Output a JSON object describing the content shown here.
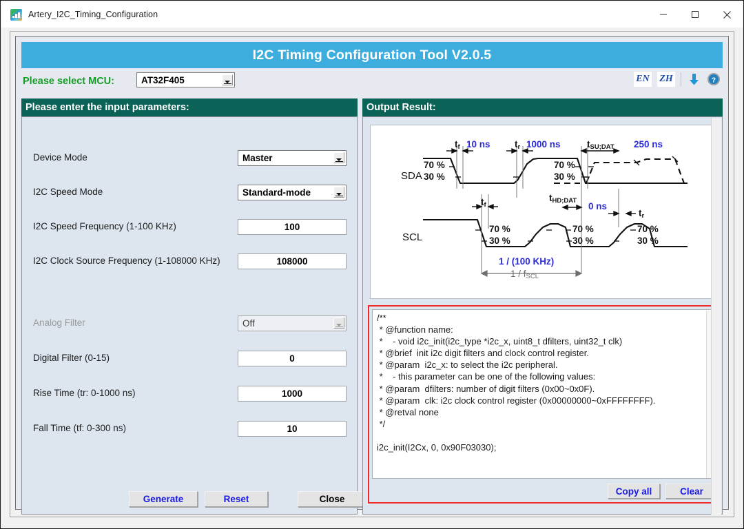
{
  "window": {
    "title": "Artery_I2C_Timing_Configuration",
    "app_icon": "artery-logo-icon",
    "controls": {
      "minimize": "minimize-icon",
      "maximize": "maximize-icon",
      "close": "close-icon"
    }
  },
  "banner": {
    "title": "I2C Timing Configuration Tool V2.0.5",
    "bg_color": "#3daddd",
    "text_color": "#ffffff"
  },
  "mcu": {
    "label": "Please select MCU:",
    "label_color": "#149d26",
    "selected": "AT32F405"
  },
  "toolbar": {
    "lang_en": "EN",
    "lang_zh": "ZH",
    "download_icon": "download-arrow-icon",
    "help_icon": "help-question-icon",
    "accent_color": "#1e49a8"
  },
  "left_panel": {
    "header": "Please enter the input parameters:",
    "header_bg": "#0b6358",
    "fields": [
      {
        "label": "Device Mode",
        "type": "combo",
        "value": "Master",
        "disabled": false
      },
      {
        "label": "I2C Speed Mode",
        "type": "combo",
        "value": "Standard-mode",
        "disabled": false
      },
      {
        "label": "I2C Speed Frequency (1-100 KHz)",
        "type": "text",
        "value": "100",
        "disabled": false
      },
      {
        "label": "I2C Clock Source Frequency (1-108000 KHz)",
        "type": "text",
        "value": "108000",
        "disabled": false
      },
      {
        "label": "Analog Filter",
        "type": "combo",
        "value": "Off",
        "disabled": true
      },
      {
        "label": "Digital Filter (0-15)",
        "type": "text",
        "value": "0",
        "disabled": false
      },
      {
        "label": "Rise Time (tr: 0-1000 ns)",
        "type": "text",
        "value": "1000",
        "disabled": false
      },
      {
        "label": "Fall Time (tf: 0-300 ns)",
        "type": "text",
        "value": "10",
        "disabled": false
      }
    ],
    "buttons": {
      "generate": "Generate",
      "reset": "Reset",
      "close": "Close"
    }
  },
  "right_panel": {
    "header": "Output Result:",
    "header_bg": "#0b6358",
    "frame_color": "#ef2a2a",
    "diagram": {
      "signals": [
        "SDA",
        "SCL"
      ],
      "levels": [
        "70 %",
        "30 %"
      ],
      "annotations": [
        {
          "symbol": "tf",
          "value": "10 ns"
        },
        {
          "symbol": "tr",
          "value": "1000 ns"
        },
        {
          "symbol": "tSU;DAT",
          "value": "250 ns"
        },
        {
          "symbol": "tHD;DAT",
          "value": "0 ns"
        },
        {
          "symbol": "1 / fSCL",
          "value": "1 / (100 KHz)"
        }
      ],
      "value_color": "#2b2bd8"
    },
    "code": "/**\n * @function name:\n *    - void i2c_init(i2c_type *i2c_x, uint8_t dfilters, uint32_t clk)\n * @brief  init i2c digit filters and clock control register.\n * @param  i2c_x: to select the i2c peripheral.\n *    - this parameter can be one of the following values:\n * @param  dfilters: number of digit filters (0x00~0x0F).\n * @param  clk: i2c clock control register (0x00000000~0xFFFFFFFF).\n * @retval none\n */\n\ni2c_init(I2Cx, 0, 0x90F03030);",
    "buttons": {
      "copy_all": "Copy all",
      "clear": "Clear"
    }
  }
}
